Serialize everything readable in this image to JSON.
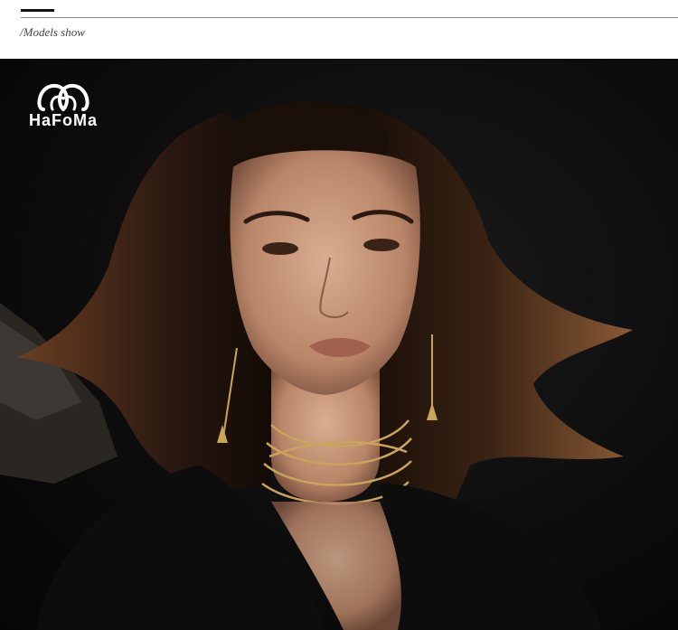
{
  "header": {
    "section_label": "/Models show"
  },
  "brand": {
    "logo_text": "HaFoMa",
    "logo_icon": "double-ring-logo-icon"
  },
  "photo": {
    "subject": "model-portrait"
  },
  "colors": {
    "background": "#0a0a0a",
    "accent": "#111111",
    "jewelry": "#c9a45a"
  }
}
